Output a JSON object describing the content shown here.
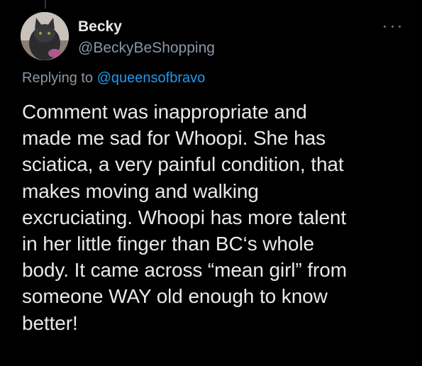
{
  "user": {
    "display_name": "Becky",
    "handle": "@BeckyBeShopping"
  },
  "reply": {
    "prefix": "Replying to ",
    "mention": "@queensofbravo"
  },
  "tweet": {
    "lines": [
      "Comment was inappropriate and",
      "made me sad for Whoopi. She has",
      "sciatica, a very painful condition, that",
      "makes moving and walking",
      "excruciating. Whoopi has more talent",
      "in her little finger than BC‘s whole",
      "body. It came across “mean girl” from",
      "someone WAY old enough to know",
      "better!"
    ]
  },
  "icons": {
    "more": "more-horizontal-icon"
  },
  "colors": {
    "background": "#000000",
    "text": "#e7e9ea",
    "secondary": "#8b98a5",
    "link": "#1d9bf0"
  }
}
